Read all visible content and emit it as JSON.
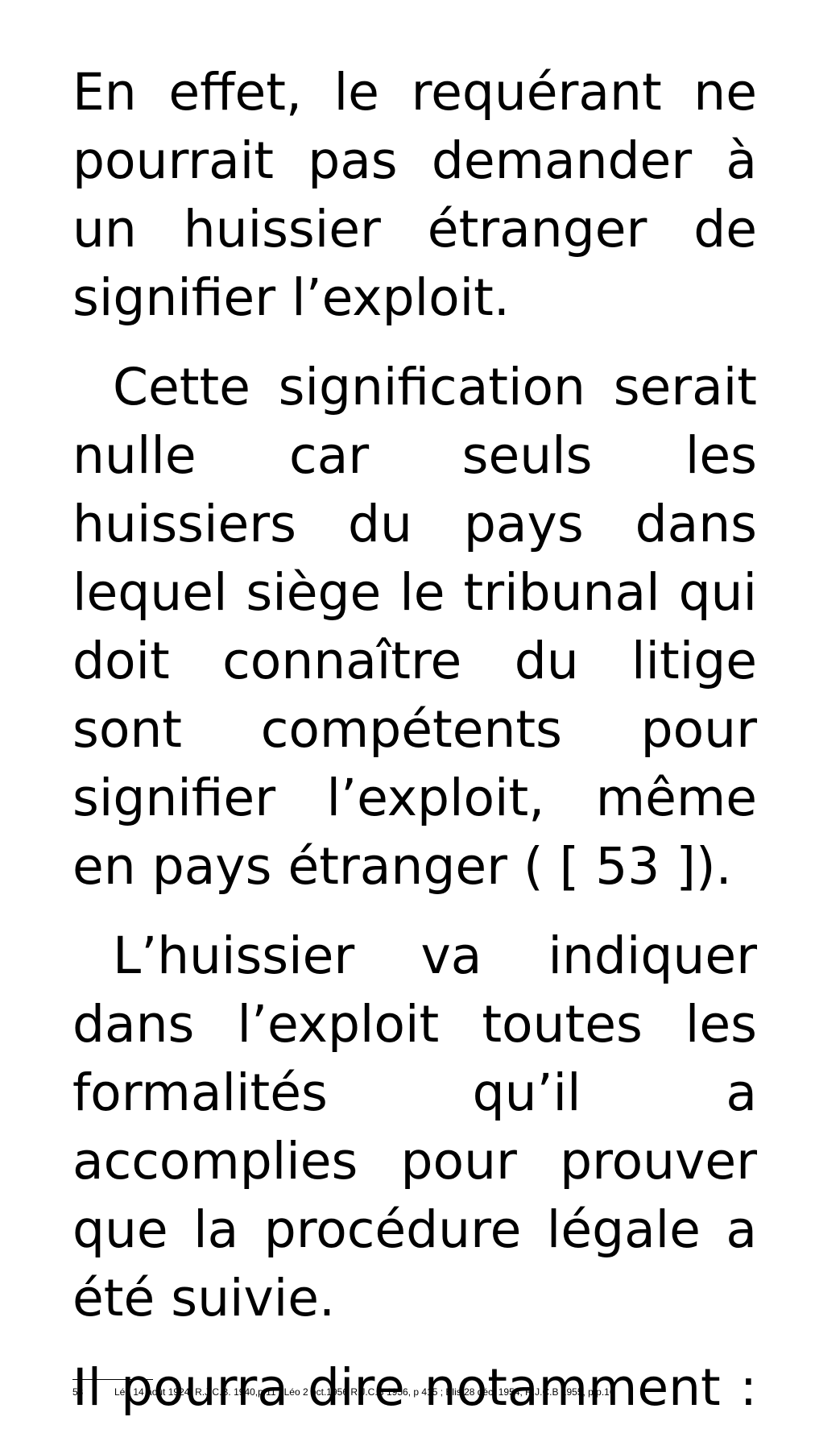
{
  "paragraphs": [
    {
      "text": "En effet, le requérant ne pourrait pas demander à un huissier étranger de signifier l’exploit."
    },
    {
      "text": "Cette  signification serait nulle car seuls les huissiers du pays dans lequel siège le tribunal qui doit connaître du litige sont compétents pour signifier l’exploit, même en pays étranger ( [ 53 ])."
    },
    {
      "text": "L’huissier va indiquer dans l’exploit toutes les formalités qu’il a accomplies pour prouver que la procédure légale a été suivie."
    },
    {
      "text": "Il pourra dire notamment :"
    }
  ],
  "footnote": {
    "number": "53",
    "text": "Léo 14 août 1924, R.J.C.B. 1940,p.11 ; Léo 2 oct.1956 R.J.C.B 1956, p 415 ; Elis 28 déc. 1954, R.J.C.B 1955, p.p.16"
  }
}
